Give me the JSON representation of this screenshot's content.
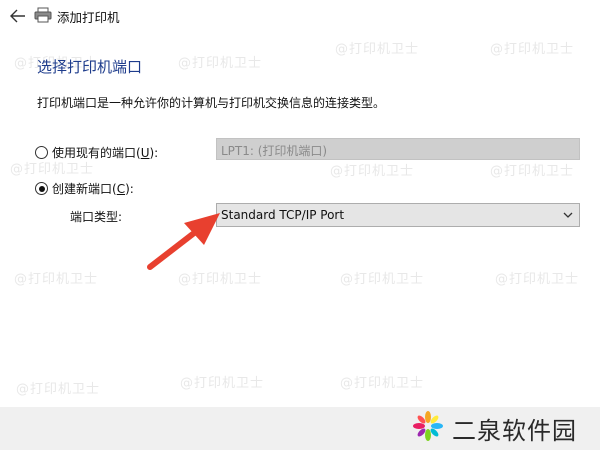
{
  "window": {
    "title": "添加打印机"
  },
  "page": {
    "heading": "选择打印机端口",
    "description": "打印机端口是一种允许你的计算机与打印机交换信息的连接类型。"
  },
  "options": {
    "existing": {
      "label_pre": "使用现有的端口(",
      "mnemonic": "U",
      "label_post": "):",
      "checked": false
    },
    "existing_port_value": "LPT1: (打印机端口)",
    "create": {
      "label_pre": "创建新端口(",
      "mnemonic": "C",
      "label_post": "):",
      "checked": true
    },
    "port_type_label": "端口类型:",
    "port_type_value": "Standard TCP/IP Port"
  },
  "watermark": "@打印机卫士",
  "logo": {
    "text": "二泉软件园"
  },
  "colors": {
    "heading": "#1e3c8c",
    "arrow": "#e8402f",
    "footer": "#f0f0f0"
  },
  "icons": {
    "back": "arrow-left",
    "printer": "printer",
    "dropdown": "chevron-down"
  }
}
